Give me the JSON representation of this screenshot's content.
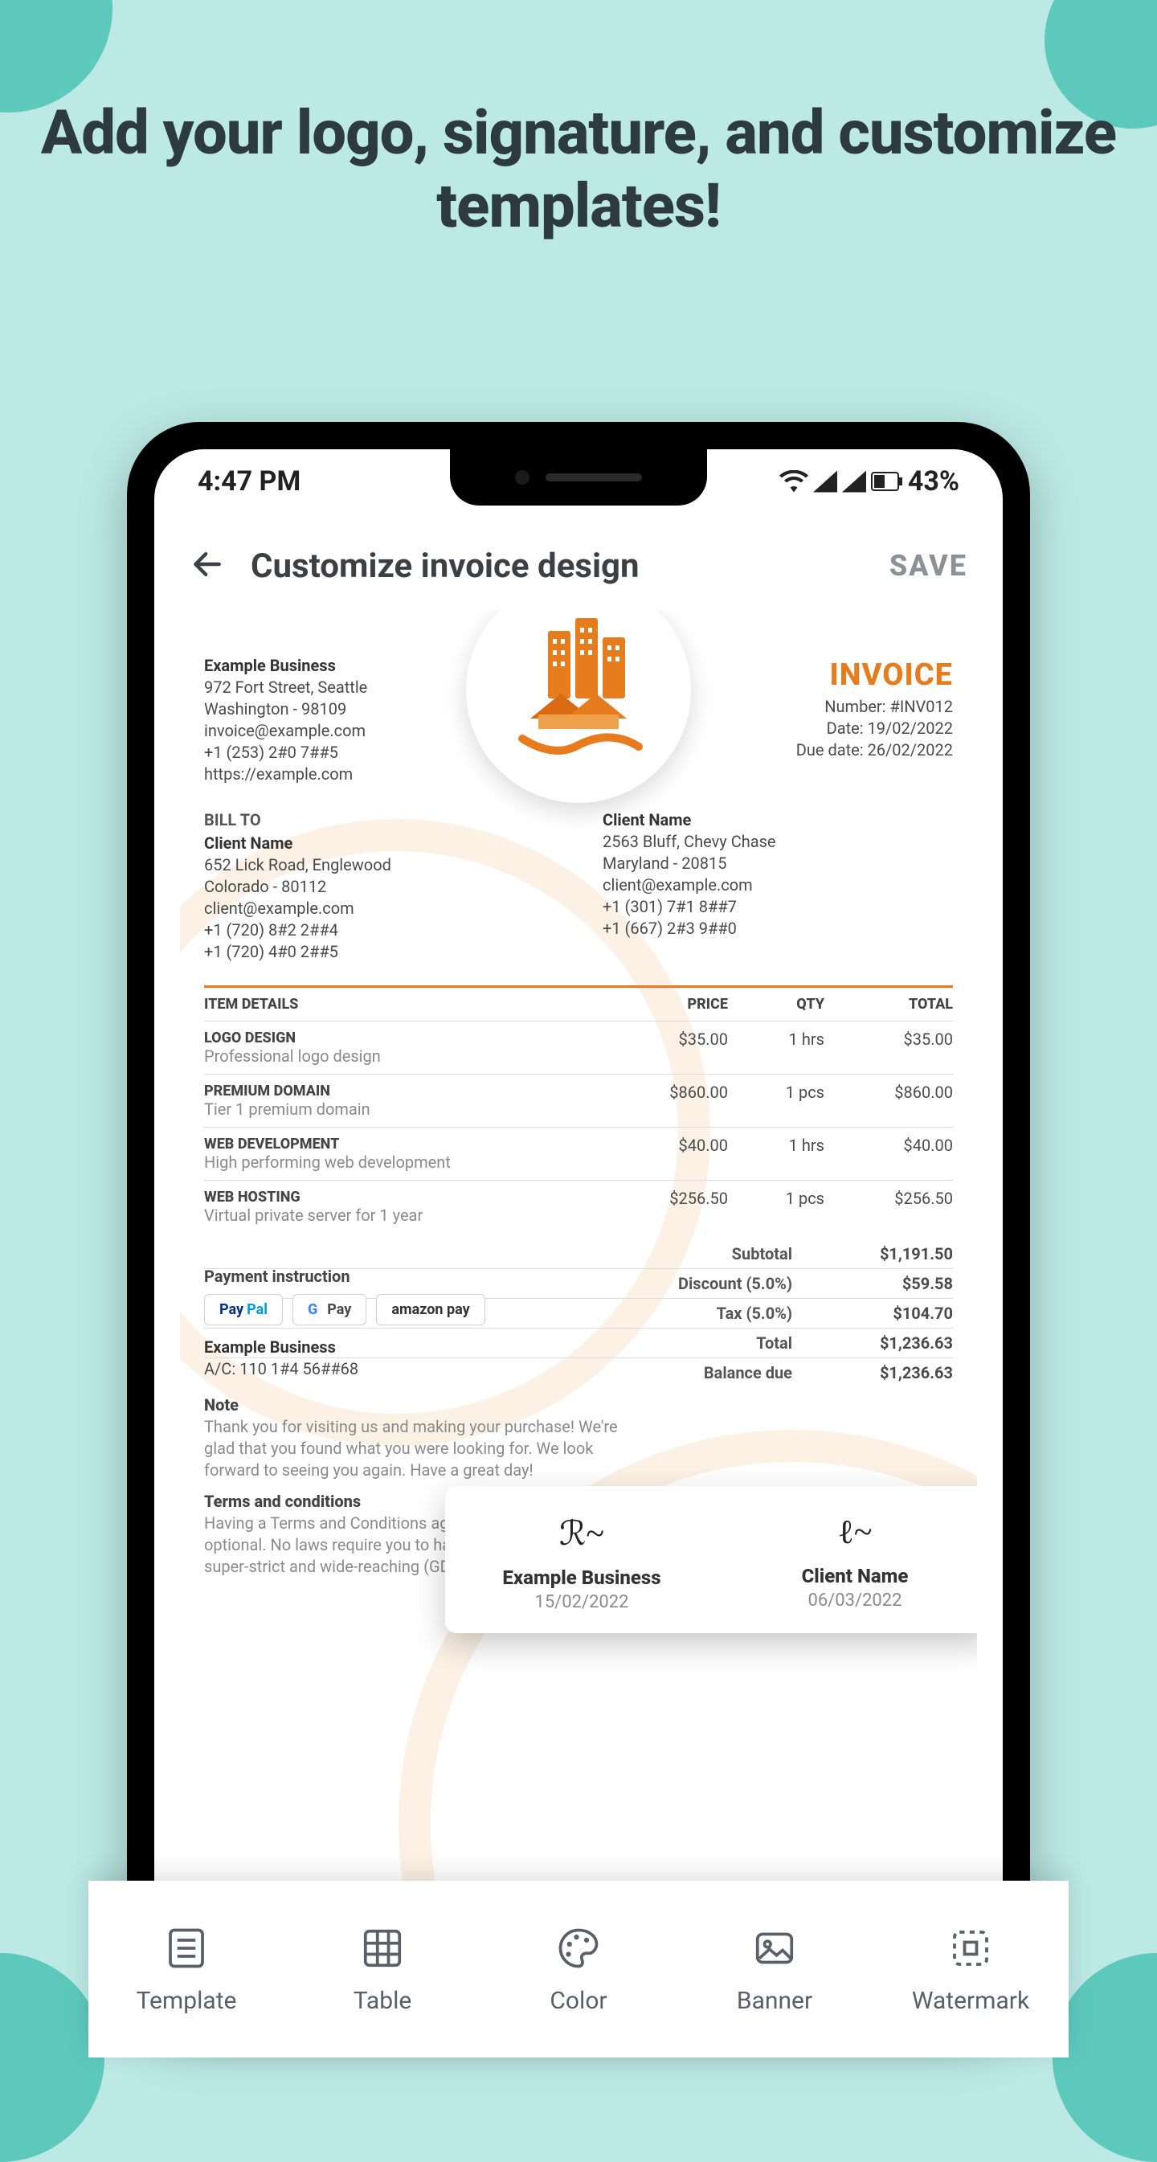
{
  "headline": "Add your logo, signature, and customize templates!",
  "status": {
    "time": "4:47 PM",
    "battery": "43%"
  },
  "appbar": {
    "title": "Customize invoice design",
    "save": "SAVE"
  },
  "from": {
    "name": "Example Business",
    "addr1": "972 Fort Street, Seattle",
    "addr2": "Washington - 98109",
    "email": "invoice@example.com",
    "phone": "+1 (253) 2#0 7##5",
    "url": "https://example.com"
  },
  "invoice": {
    "title": "INVOICE",
    "number_label": "Number: #INV012",
    "date_label": "Date: 19/02/2022",
    "due_label": "Due date: 26/02/2022"
  },
  "bill": {
    "label": "BILL TO",
    "name": "Client Name",
    "addr1": "652 Lick Road, Englewood",
    "addr2": "Colorado - 80112",
    "email": "client@example.com",
    "phone1": "+1 (720) 8#2 2##4",
    "phone2": "+1 (720) 4#0 2##5"
  },
  "ship": {
    "name": "Client Name",
    "addr1": "2563 Bluff, Chevy Chase",
    "addr2": "Maryland - 20815",
    "email": "client@example.com",
    "phone1": "+1 (301) 7#1 8##7",
    "phone2": "+1 (667) 2#3 9##0"
  },
  "columns": {
    "details": "ITEM DETAILS",
    "price": "PRICE",
    "qty": "QTY",
    "total": "TOTAL"
  },
  "items": [
    {
      "name": "LOGO DESIGN",
      "desc": "Professional logo design",
      "price": "$35.00",
      "qty": "1 hrs",
      "total": "$35.00"
    },
    {
      "name": "PREMIUM DOMAIN",
      "desc": "Tier 1 premium domain",
      "price": "$860.00",
      "qty": "1 pcs",
      "total": "$860.00"
    },
    {
      "name": "WEB DEVELOPMENT",
      "desc": "High performing web development",
      "price": "$40.00",
      "qty": "1 hrs",
      "total": "$40.00"
    },
    {
      "name": "WEB HOSTING",
      "desc": "Virtual private server for 1 year",
      "price": "$256.50",
      "qty": "1 pcs",
      "total": "$256.50"
    }
  ],
  "totals": {
    "subtotal_l": "Subtotal",
    "subtotal_v": "$1,191.50",
    "discount_l": "Discount (5.0%)",
    "discount_v": "$59.58",
    "tax_l": "Tax (5.0%)",
    "tax_v": "$104.70",
    "total_l": "Total",
    "total_v": "$1,236.63",
    "balance_l": "Balance due",
    "balance_v": "$1,236.63"
  },
  "payment": {
    "label": "Payment instruction",
    "paypal": "PayPal",
    "gpay": "G Pay",
    "amazon": "amazon pay",
    "acct_name": "Example Business",
    "acct_no": "A/C: 110 1#4 56##68"
  },
  "note": {
    "hd": "Note",
    "bd": "Thank you for visiting us and making your purchase! We're glad that you found what you were looking for. We look forward to seeing you again. Have a great day!"
  },
  "terms": {
    "hd": "Terms and conditions",
    "bd": "Having a Terms and Conditions agreement is completely optional. No laws require you to have one. Not even the super-strict and wide-reaching (GDPR)."
  },
  "signature": {
    "left_name": "Example Business",
    "left_date": "15/02/2022",
    "right_name": "Client Name",
    "right_date": "06/03/2022"
  },
  "dock": {
    "template": "Template",
    "table": "Table",
    "color": "Color",
    "banner": "Banner",
    "watermark": "Watermark"
  }
}
